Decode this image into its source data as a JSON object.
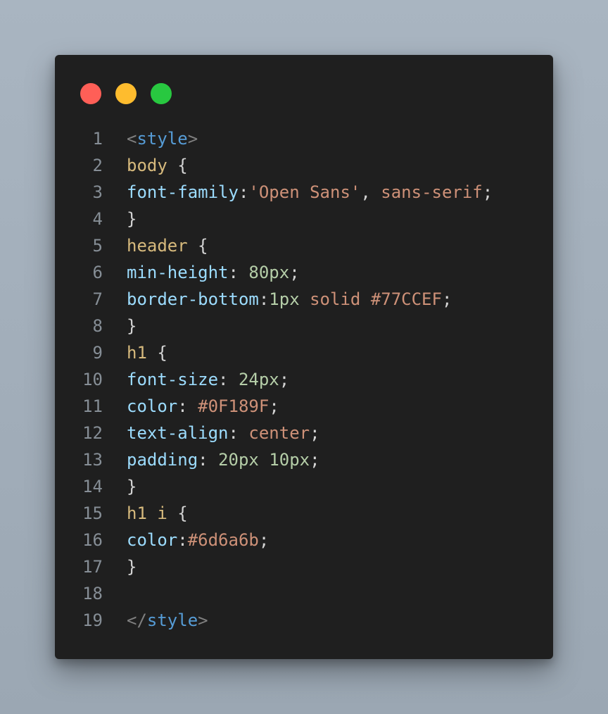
{
  "window": {
    "controls": [
      {
        "name": "close",
        "color": "#ff5f57"
      },
      {
        "name": "minimize",
        "color": "#febc2e"
      },
      {
        "name": "zoom",
        "color": "#28c840"
      }
    ]
  },
  "colors": {
    "background": "#a3afbb",
    "editor_background": "#1f1f1f",
    "line_number": "#868e96",
    "punctuation": "#808080",
    "tag": "#569cd6",
    "selector": "#d7ba7d",
    "property": "#9cdcfe",
    "string": "#ce9178",
    "number": "#b5cea8",
    "plain": "#d4d4d4"
  },
  "code": {
    "lines": [
      {
        "number": "1",
        "tokens": [
          {
            "text": "<",
            "kind": "punct"
          },
          {
            "text": "style",
            "kind": "tag"
          },
          {
            "text": ">",
            "kind": "punct"
          }
        ]
      },
      {
        "number": "2",
        "tokens": [
          {
            "text": "body",
            "kind": "sel"
          },
          {
            "text": " {",
            "kind": "plain"
          }
        ]
      },
      {
        "number": "3",
        "tokens": [
          {
            "text": "font-family",
            "kind": "prop"
          },
          {
            "text": ":",
            "kind": "plain"
          },
          {
            "text": "'Open Sans'",
            "kind": "str"
          },
          {
            "text": ", ",
            "kind": "plain"
          },
          {
            "text": "sans-serif",
            "kind": "str"
          },
          {
            "text": ";",
            "kind": "plain"
          }
        ]
      },
      {
        "number": "4",
        "tokens": [
          {
            "text": "}",
            "kind": "plain"
          }
        ]
      },
      {
        "number": "5",
        "tokens": [
          {
            "text": "header",
            "kind": "sel"
          },
          {
            "text": " {",
            "kind": "plain"
          }
        ]
      },
      {
        "number": "6",
        "tokens": [
          {
            "text": "min-height",
            "kind": "prop"
          },
          {
            "text": ": ",
            "kind": "plain"
          },
          {
            "text": "80px",
            "kind": "num"
          },
          {
            "text": ";",
            "kind": "plain"
          }
        ]
      },
      {
        "number": "7",
        "tokens": [
          {
            "text": "border-bottom",
            "kind": "prop"
          },
          {
            "text": ":",
            "kind": "plain"
          },
          {
            "text": "1px",
            "kind": "num"
          },
          {
            "text": " ",
            "kind": "plain"
          },
          {
            "text": "solid",
            "kind": "str"
          },
          {
            "text": " ",
            "kind": "plain"
          },
          {
            "text": "#77CCEF",
            "kind": "str"
          },
          {
            "text": ";",
            "kind": "plain"
          }
        ]
      },
      {
        "number": "8",
        "tokens": [
          {
            "text": "}",
            "kind": "plain"
          }
        ]
      },
      {
        "number": "9",
        "tokens": [
          {
            "text": "h1",
            "kind": "sel"
          },
          {
            "text": " {",
            "kind": "plain"
          }
        ]
      },
      {
        "number": "10",
        "tokens": [
          {
            "text": "font-size",
            "kind": "prop"
          },
          {
            "text": ": ",
            "kind": "plain"
          },
          {
            "text": "24px",
            "kind": "num"
          },
          {
            "text": ";",
            "kind": "plain"
          }
        ]
      },
      {
        "number": "11",
        "tokens": [
          {
            "text": "color",
            "kind": "prop"
          },
          {
            "text": ": ",
            "kind": "plain"
          },
          {
            "text": "#0F189F",
            "kind": "str"
          },
          {
            "text": ";",
            "kind": "plain"
          }
        ]
      },
      {
        "number": "12",
        "tokens": [
          {
            "text": "text-align",
            "kind": "prop"
          },
          {
            "text": ": ",
            "kind": "plain"
          },
          {
            "text": "center",
            "kind": "str"
          },
          {
            "text": ";",
            "kind": "plain"
          }
        ]
      },
      {
        "number": "13",
        "tokens": [
          {
            "text": "padding",
            "kind": "prop"
          },
          {
            "text": ": ",
            "kind": "plain"
          },
          {
            "text": "20px",
            "kind": "num"
          },
          {
            "text": " ",
            "kind": "plain"
          },
          {
            "text": "10px",
            "kind": "num"
          },
          {
            "text": ";",
            "kind": "plain"
          }
        ]
      },
      {
        "number": "14",
        "tokens": [
          {
            "text": "}",
            "kind": "plain"
          }
        ]
      },
      {
        "number": "15",
        "tokens": [
          {
            "text": "h1 i",
            "kind": "sel"
          },
          {
            "text": " {",
            "kind": "plain"
          }
        ]
      },
      {
        "number": "16",
        "tokens": [
          {
            "text": "color",
            "kind": "prop"
          },
          {
            "text": ":",
            "kind": "plain"
          },
          {
            "text": "#6d6a6b",
            "kind": "str"
          },
          {
            "text": ";",
            "kind": "plain"
          }
        ]
      },
      {
        "number": "17",
        "tokens": [
          {
            "text": "}",
            "kind": "plain"
          }
        ]
      },
      {
        "number": "18",
        "tokens": []
      },
      {
        "number": "19",
        "tokens": [
          {
            "text": "</",
            "kind": "punct"
          },
          {
            "text": "style",
            "kind": "tag"
          },
          {
            "text": ">",
            "kind": "punct"
          }
        ]
      }
    ]
  }
}
